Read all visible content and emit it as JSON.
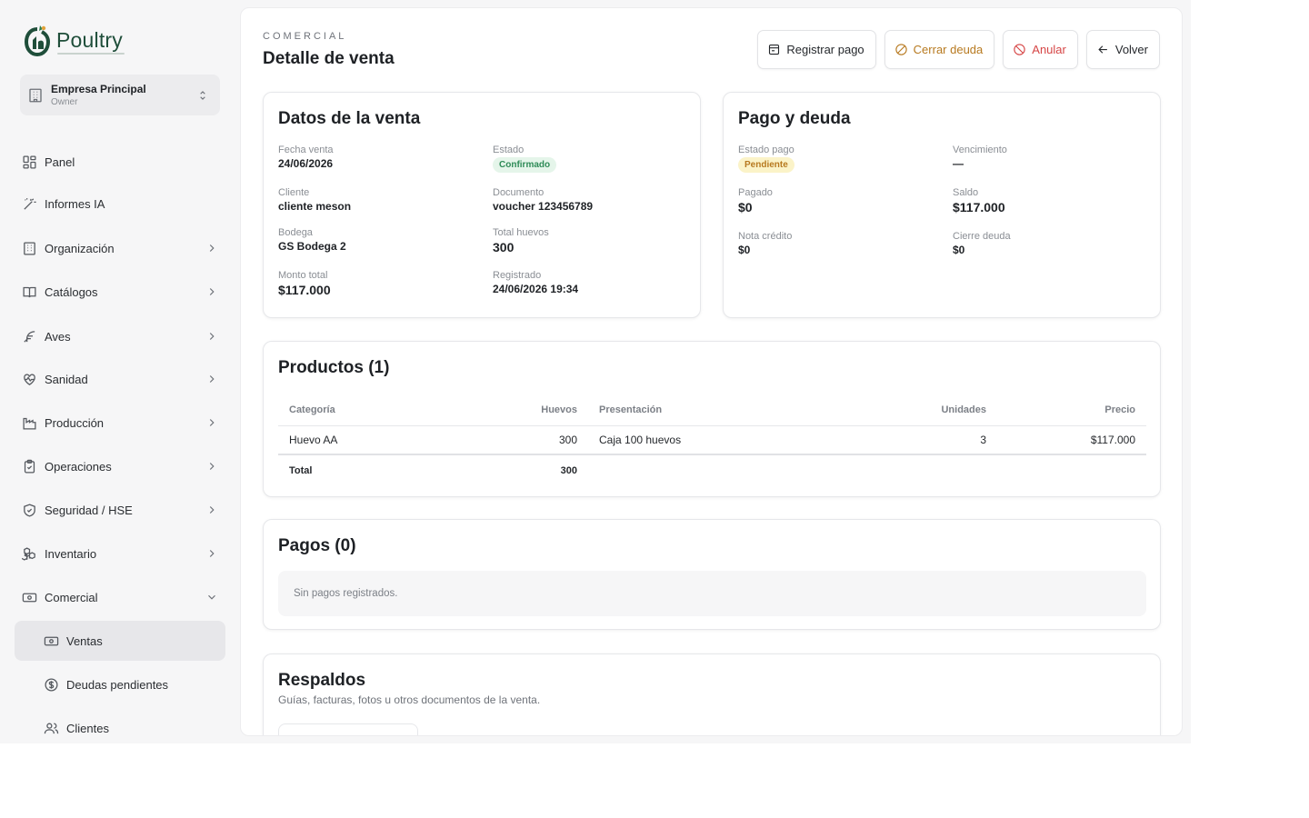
{
  "brand": {
    "name": "Poultry",
    "accent": "#1f4e3a"
  },
  "company": {
    "name": "Empresa Principal",
    "role": "Owner"
  },
  "nav": [
    {
      "label": "Panel",
      "icon": "grid-icon"
    },
    {
      "label": "Informes IA",
      "icon": "wand-icon"
    },
    {
      "label": "Organización",
      "icon": "building-icon"
    },
    {
      "label": "Catálogos",
      "icon": "book-icon"
    },
    {
      "label": "Aves",
      "icon": "feather-icon"
    },
    {
      "label": "Sanidad",
      "icon": "heart-pulse-icon"
    },
    {
      "label": "Producción",
      "icon": "factory-icon"
    },
    {
      "label": "Operaciones",
      "icon": "clipboard-icon"
    },
    {
      "label": "Seguridad / HSE",
      "icon": "shield-icon"
    },
    {
      "label": "Inventario",
      "icon": "boxes-icon"
    },
    {
      "label": "Comercial",
      "icon": "cash-icon"
    }
  ],
  "subnav": [
    {
      "label": "Ventas",
      "icon": "cash-icon",
      "active": true
    },
    {
      "label": "Deudas pendientes",
      "icon": "dollar-circle-icon"
    },
    {
      "label": "Clientes",
      "icon": "users-icon"
    }
  ],
  "header": {
    "section": "COMERCIAL",
    "title": "Detalle de venta",
    "actions": {
      "register": "Registrar pago",
      "close_debt": "Cerrar deuda",
      "cancel": "Anular",
      "back": "Volver"
    }
  },
  "sale": {
    "title": "Datos de la venta",
    "fecha_label": "Fecha venta",
    "fecha": "24/06/2026",
    "estado_label": "Estado",
    "estado": "Confirmado",
    "cliente_label": "Cliente",
    "cliente": "cliente meson",
    "documento_label": "Documento",
    "documento": "voucher 123456789",
    "bodega_label": "Bodega",
    "bodega": "GS Bodega 2",
    "huevos_label": "Total huevos",
    "huevos": "300",
    "monto_label": "Monto total",
    "monto": "$117.000",
    "registrado_label": "Registrado",
    "registrado": "24/06/2026 19:34"
  },
  "payment": {
    "title": "Pago y deuda",
    "estado_label": "Estado pago",
    "estado": "Pendiente",
    "venc_label": "Vencimiento",
    "venc": "—",
    "pagado_label": "Pagado",
    "pagado": "$0",
    "saldo_label": "Saldo",
    "saldo": "$117.000",
    "nota_label": "Nota crédito",
    "nota": "$0",
    "cierre_label": "Cierre deuda",
    "cierre": "$0"
  },
  "products": {
    "title": "Productos (1)",
    "headers": {
      "categoria": "Categoría",
      "huevos": "Huevos",
      "presentacion": "Presentación",
      "unidades": "Unidades",
      "precio": "Precio"
    },
    "rows": [
      {
        "categoria": "Huevo AA",
        "huevos": "300",
        "presentacion": "Caja 100 huevos",
        "unidades": "3",
        "precio": "$117.000"
      }
    ],
    "total_label": "Total",
    "total_huevos": "300"
  },
  "payments": {
    "title": "Pagos (0)",
    "empty": "Sin pagos registrados."
  },
  "backups": {
    "title": "Respaldos",
    "subtitle": "Guías, facturas, fotos u otros documentos de la venta."
  }
}
